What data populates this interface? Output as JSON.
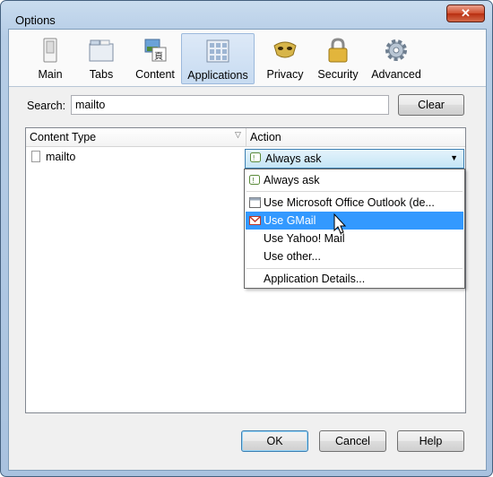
{
  "window": {
    "title": "Options"
  },
  "toolbar": {
    "items": [
      {
        "label": "Main",
        "icon": "switch-icon"
      },
      {
        "label": "Tabs",
        "icon": "tabs-icon"
      },
      {
        "label": "Content",
        "icon": "content-icon"
      },
      {
        "label": "Applications",
        "icon": "applications-icon",
        "selected": true
      },
      {
        "label": "Privacy",
        "icon": "mask-icon"
      },
      {
        "label": "Security",
        "icon": "lock-icon"
      },
      {
        "label": "Advanced",
        "icon": "gear-icon"
      }
    ]
  },
  "search": {
    "label": "Search:",
    "value": "mailto",
    "clear_label": "Clear"
  },
  "table": {
    "columns": [
      "Content Type",
      "Action"
    ],
    "rows": [
      {
        "type": "mailto",
        "action": "Always ask"
      }
    ]
  },
  "dropdown": {
    "items": [
      {
        "label": "Always ask"
      },
      {
        "label": "Use Microsoft Office Outlook (de..."
      },
      {
        "label": "Use GMail",
        "highlighted": true
      },
      {
        "label": "Use Yahoo! Mail"
      },
      {
        "label": "Use other..."
      },
      {
        "label": "Application Details..."
      }
    ]
  },
  "buttons": {
    "ok": "OK",
    "cancel": "Cancel",
    "help": "Help"
  },
  "colors": {
    "selection": "#3399ff",
    "title_gradient": "#b6cde6"
  }
}
